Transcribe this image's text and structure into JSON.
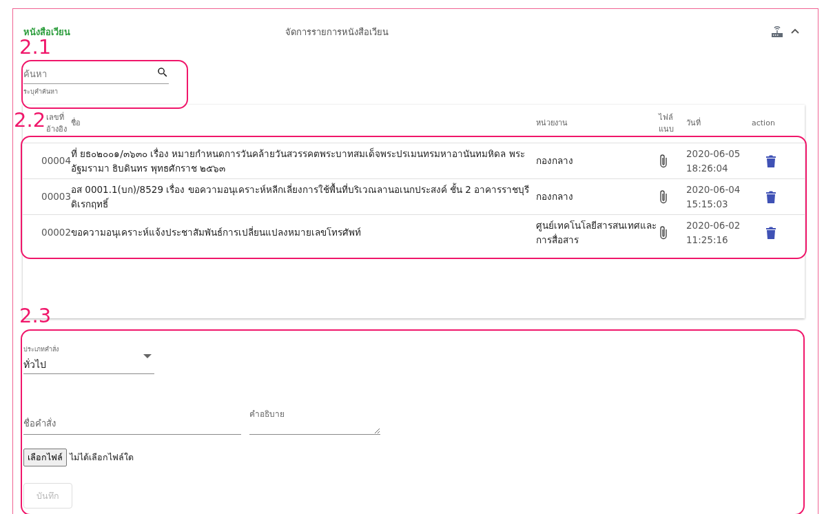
{
  "header": {
    "title": "หนังสือเวียน",
    "subtitle": "จัดการรายการหนังสือเวียน",
    "expanded": true
  },
  "search": {
    "placeholder": "ค้นหา",
    "helper": "ระบุคำค้นหา"
  },
  "table": {
    "columns": [
      "เลขที่อ้างอิง",
      "ชื่อ",
      "หน่วยงาน",
      "ไฟล์แนบ",
      "วันที่",
      "action"
    ],
    "rows": [
      {
        "ref": "00004",
        "name": "ที่ ยธ๐๒๐๐๑/๓๖๓๐ เรื่อง หมายกำหนดการวันคล้ายวันสวรรคตพระบาทสมเด็จพระปรเมนทรมหาอานันทมหิดล พระอัฐมรามา ธิบดินทร พุทธศักราช ๒๕๖๓",
        "department": "กองกลาง",
        "date": "2020-06-05",
        "time": "18:26:04"
      },
      {
        "ref": "00003",
        "name": "อส 0001.1(บก)/8529 เรื่อง ขอความอนุเคราะห์หลีกเลี่ยงการใช้พื้นที่บริเวณลานอเนกประสงค์ ชั้น 2 อาคารราชบุรีดิเรกฤทธิ์",
        "department": "กองกลาง",
        "date": "2020-06-04",
        "time": "15:15:03"
      },
      {
        "ref": "00002",
        "name": "ขอความอนุเคราะห์แจ้งประชาสัมพันธ์การเปลี่ยนแปลงหมายเลขโทรศัพท์",
        "department": "ศูนย์เทคโนโลยีสารสนเทศและการสื่อสาร",
        "date": "2020-06-02",
        "time": "11:25:16"
      }
    ]
  },
  "form": {
    "type_label": "ประเภทคำสั่ง",
    "type_value": "ทั่วไป",
    "name_placeholder": "ชื่อคำสั่ง",
    "description_label": "คำอธิบาย",
    "file_button": "เลือกไฟล์",
    "file_status": "ไม่ได้เลือกไฟล์ใด",
    "save_button": "บันทึก",
    "save_disabled": true
  },
  "annotations": [
    {
      "label": "2.1"
    },
    {
      "label": "2.2"
    },
    {
      "label": "2.3"
    }
  ]
}
